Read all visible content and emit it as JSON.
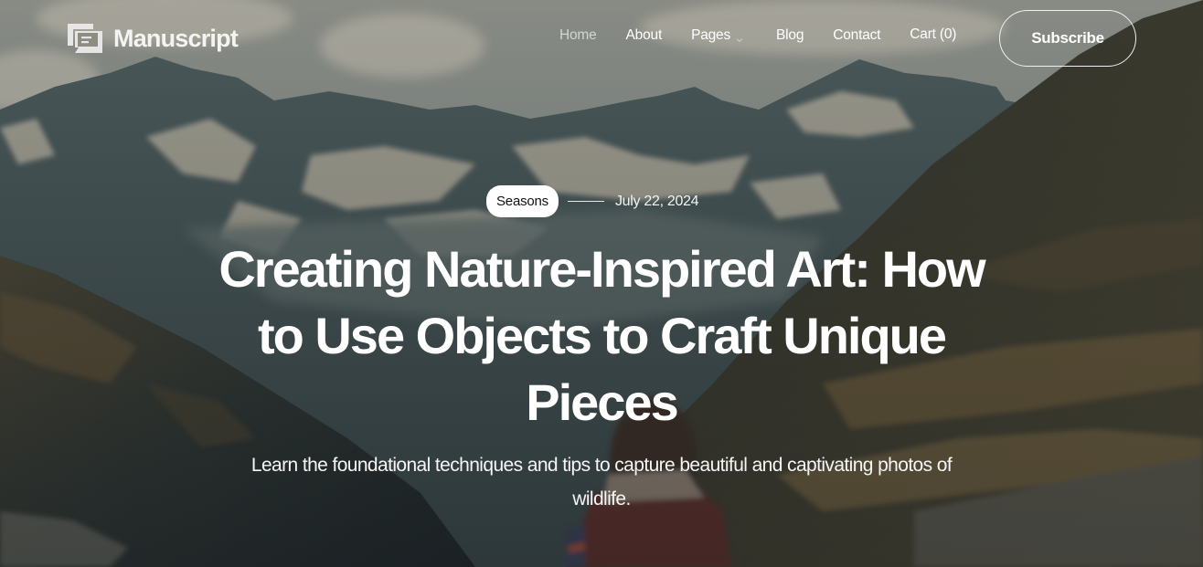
{
  "site": {
    "brand_name": "Manuscript",
    "logo_icon": "chat-bubbles-icon"
  },
  "nav": {
    "items": [
      {
        "label": "Home",
        "active": true
      },
      {
        "label": "About",
        "active": false
      },
      {
        "label": "Pages",
        "active": false,
        "has_dropdown": true
      },
      {
        "label": "Blog",
        "active": false
      },
      {
        "label": "Contact",
        "active": false
      },
      {
        "label": "Cart (0)",
        "active": false
      }
    ],
    "subscribe_label": "Subscribe"
  },
  "post": {
    "category": "Seasons",
    "date": "July 22, 2024",
    "title": "Creating Nature-Inspired Art: How to Use Objects to Craft Unique Pieces",
    "subtitle": "Learn the foundational techniques and tips to capture beautiful and captivating photos of wildlife."
  },
  "colors": {
    "text": "#ffffff",
    "nav_active": "#d3d5d3",
    "badge_bg": "#ffffff",
    "badge_text": "#111111"
  }
}
